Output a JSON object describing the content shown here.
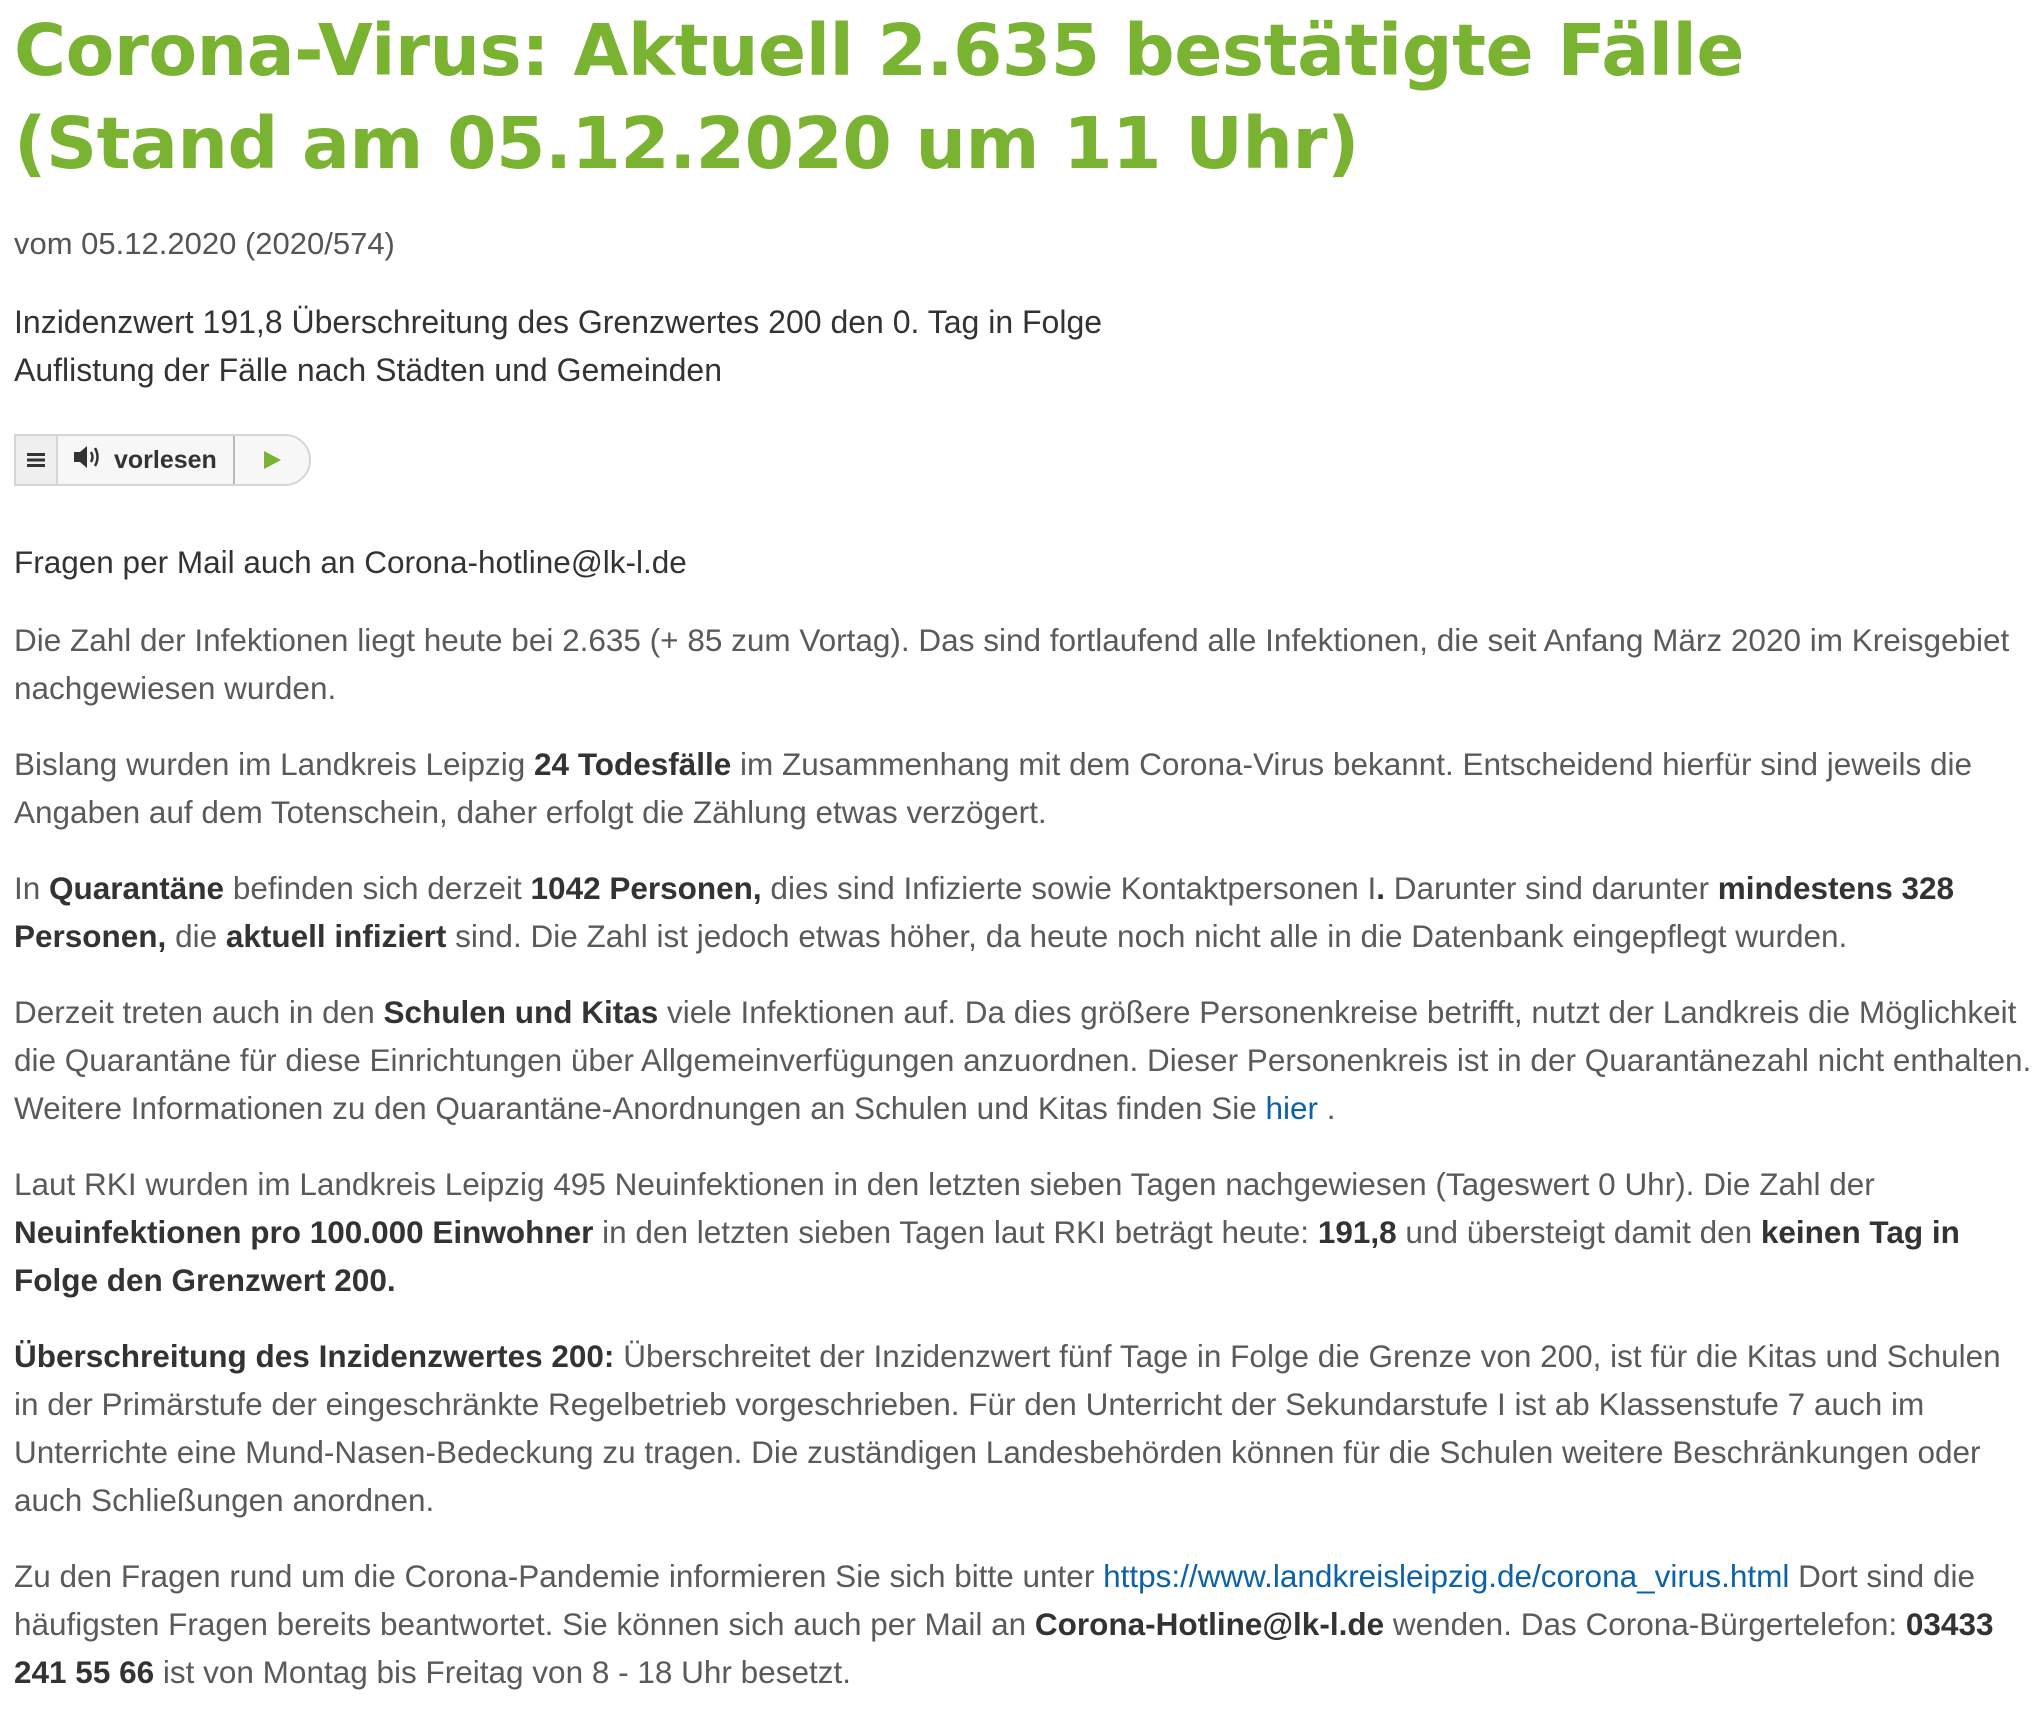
{
  "article": {
    "title": "Corona-Virus: Aktuell 2.635 bestätigte Fälle (Stand am 05.12.2020 um 11 Uhr)",
    "meta": "vom 05.12.2020 (2020/574)",
    "teaser_line1": "Inzidenzwert 191,8 Überschreitung des Grenzwertes 200 den 0. Tag in Folge",
    "teaser_line2": "Auflistung der Fälle nach Städten und Gemeinden"
  },
  "reader": {
    "menu_icon": "menu-icon",
    "speaker_icon": "speaker-icon",
    "label": "vorlesen",
    "play_icon": "play-icon",
    "accent_color": "#7ab332"
  },
  "paragraphs": {
    "p1": "Fragen per Mail auch an Corona-hotline@lk-l.de",
    "p2": "Die Zahl der Infektionen liegt heute bei 2.635 (+ 85 zum Vortag). Das sind fortlaufend alle Infektionen, die seit Anfang März 2020 im Kreisgebiet nachgewiesen wurden.",
    "p3": {
      "a": "Bislang wurden im Landkreis Leipzig ",
      "b": "24 Todesfälle",
      "c": " im Zusammenhang mit dem Corona-Virus bekannt. Entscheidend hierfür sind jeweils die Angaben auf dem Totenschein, daher erfolgt die Zählung etwas verzögert."
    },
    "p4": {
      "a": "In ",
      "b": "Quarantäne",
      "c": " befinden sich derzeit ",
      "d": "1042 Personen,",
      "e": " dies sind Infizierte sowie Kontaktpersonen I",
      "f": ".",
      "g": " Darunter sind darunter ",
      "h": "mindestens 328 Personen,",
      "i": " die ",
      "j": "aktuell infiziert",
      "k": " sind. Die Zahl ist jedoch etwas höher, da heute noch nicht alle in die Datenbank eingepflegt wurden."
    },
    "p5": {
      "a": "Derzeit treten auch in den ",
      "b": "Schulen und Kitas",
      "c": " viele Infektionen auf. Da dies größere Personenkreise betrifft, nutzt der Landkreis die Möglichkeit die Quarantäne für diese Einrichtungen über Allgemeinverfügungen anzuordnen. Dieser Personenkreis ist in der Quarantänezahl nicht enthalten. Weitere Informationen zu den Quarantäne-Anordnungen an Schulen und Kitas finden Sie ",
      "link": "hier",
      "d": " ."
    },
    "p6": {
      "a": "Laut RKI wurden im Landkreis Leipzig 495 Neuinfektionen in den letzten sieben Tagen nachgewiesen (Tageswert 0 Uhr). Die Zahl der ",
      "b": "Neuinfektionen pro 100.000 Einwohner",
      "c": " in den letzten sieben Tagen laut RKI beträgt heute: ",
      "d": "191,8",
      "e": " und übersteigt damit den ",
      "f": "keinen Tag in Folge den Grenzwert 200."
    },
    "p7": {
      "a": "Überschreitung des Inzidenzwertes 200:",
      "b": " Überschreitet der Inzidenzwert fünf Tage in Folge die Grenze von 200, ist für die Kitas und Schulen in der Primärstufe der eingeschränkte Regelbetrieb vorgeschrieben. Für den Unterricht der Sekundarstufe I ist ab Klassenstufe 7 auch im Unterrichte eine Mund-Nasen-Bedeckung zu tragen. Die zuständigen Landesbehörden können für die Schulen weitere Beschränkungen oder auch Schließungen anordnen."
    },
    "p8": {
      "a": "Zu den Fragen rund um die Corona-Pandemie informieren Sie sich bitte unter ",
      "link": "https://www.landkreisleipzig.de/corona_virus.html",
      "b": " Dort sind die häufigsten Fragen bereits beantwortet. Sie können sich auch per Mail an ",
      "c": "Corona-Hotline@lk-l.de",
      "d": " wenden. Das Corona-Bürgertelefon: ",
      "e": "03433 241 55 66",
      "f": " ist von Montag bis Freitag von 8 - 18 Uhr besetzt."
    }
  },
  "colors": {
    "title": "#7ab332",
    "link": "#0b62a8",
    "text": "#5a5a5a",
    "strong": "#333333"
  }
}
